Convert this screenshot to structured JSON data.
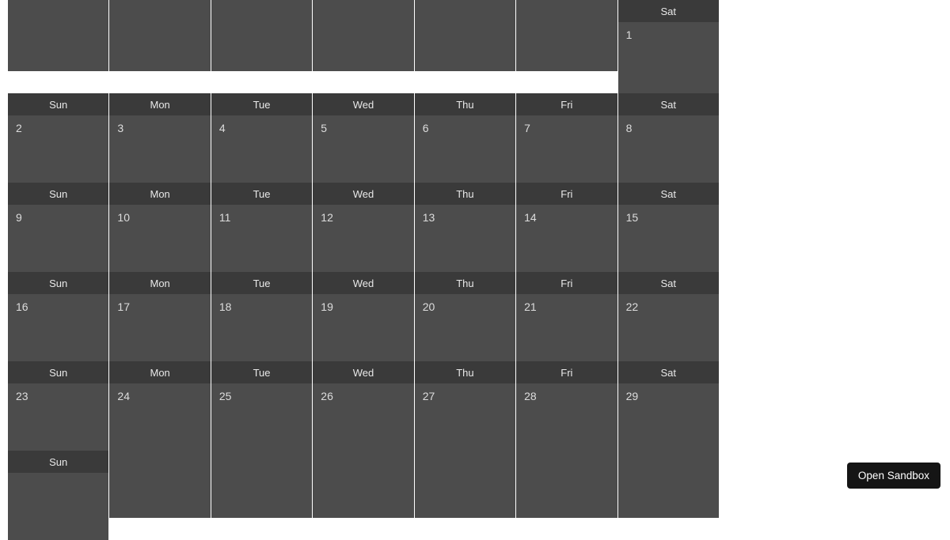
{
  "day_labels": [
    "Sun",
    "Mon",
    "Tue",
    "Wed",
    "Thu",
    "Fri",
    "Sat"
  ],
  "weeks": [
    {
      "show_headers": [
        false,
        false,
        false,
        false,
        false,
        false,
        true
      ],
      "days": [
        "",
        "",
        "",
        "",
        "",
        "",
        "1"
      ]
    },
    {
      "show_headers": [
        true,
        true,
        true,
        true,
        true,
        true,
        true
      ],
      "days": [
        "2",
        "3",
        "4",
        "5",
        "6",
        "7",
        "8"
      ]
    },
    {
      "show_headers": [
        true,
        true,
        true,
        true,
        true,
        true,
        true
      ],
      "days": [
        "9",
        "10",
        "11",
        "12",
        "13",
        "14",
        "15"
      ]
    },
    {
      "show_headers": [
        true,
        true,
        true,
        true,
        true,
        true,
        true
      ],
      "days": [
        "16",
        "17",
        "18",
        "19",
        "20",
        "21",
        "22"
      ]
    },
    {
      "show_headers": [
        true,
        true,
        true,
        true,
        true,
        true,
        true
      ],
      "days": [
        "23",
        "24",
        "25",
        "26",
        "27",
        "28",
        "29"
      ]
    },
    {
      "show_headers": [
        true,
        false,
        false,
        false,
        false,
        false,
        false
      ],
      "days": [
        "",
        "",
        "",
        "",
        "",
        "",
        ""
      ]
    }
  ],
  "button": {
    "open_sandbox": "Open Sandbox"
  }
}
